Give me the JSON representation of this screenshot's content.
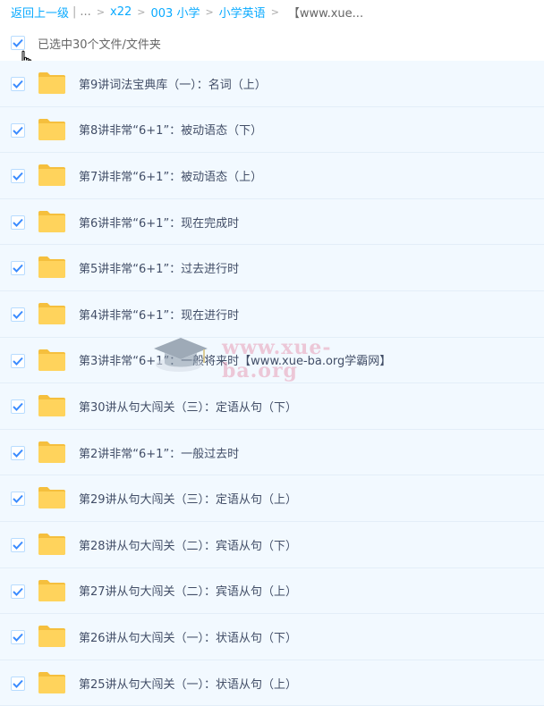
{
  "breadcrumb": {
    "back": "返回上一级",
    "bar": "|",
    "ellipsis": "...",
    "sep": ">",
    "path": [
      "x22",
      "003 小学",
      "小学英语"
    ],
    "current": "【www.xue..."
  },
  "selection": {
    "text": "已选中30个文件/文件夹",
    "checked": true
  },
  "files": [
    {
      "name": "第9讲词法宝典库（一）：名词（上）"
    },
    {
      "name": "第8讲非常“6+1”：被动语态（下）"
    },
    {
      "name": "第7讲非常“6+1”：被动语态（上）"
    },
    {
      "name": "第6讲非常“6+1”：现在完成时"
    },
    {
      "name": "第5讲非常“6+1”：过去进行时"
    },
    {
      "name": "第4讲非常“6+1”：现在进行时"
    },
    {
      "name": "第3讲非常“6+1”：一般将来时【www.xue-ba.org学霸网】"
    },
    {
      "name": "第30讲从句大闯关（三）：定语从句（下）"
    },
    {
      "name": "第2讲非常“6+1”：一般过去时"
    },
    {
      "name": "第29讲从句大闯关（三）：定语从句（上）"
    },
    {
      "name": "第28讲从句大闯关（二）：宾语从句（下）"
    },
    {
      "name": "第27讲从句大闯关（二）：宾语从句（上）"
    },
    {
      "name": "第26讲从句大闯关（一）：状语从句（下）"
    },
    {
      "name": "第25讲从句大闯关（一）：状语从句（上）"
    }
  ],
  "watermark": {
    "text": "www.xue-ba.org"
  },
  "colors": {
    "link": "#09aaff",
    "check": "#3b8cff",
    "folder": "#ffd35c",
    "row_bg": "#f2f9ff"
  }
}
